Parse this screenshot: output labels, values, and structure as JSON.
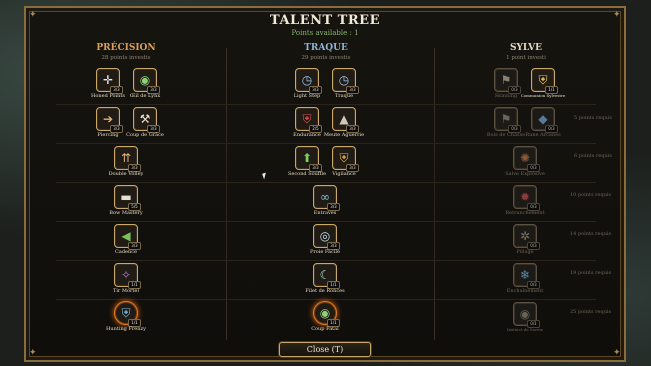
{
  "header": {
    "title": "TALENT TREE",
    "points_available": "Points available : 1"
  },
  "columns": [
    {
      "name": "PRÉCISION",
      "invested": "28 points investis",
      "color": "#d9a05b"
    },
    {
      "name": "TRAQUE",
      "invested": "29 points investis",
      "color": "#8fb3d9"
    },
    {
      "name": "SYLVE",
      "invested": "1 point investi",
      "color": "#e6dcc4"
    }
  ],
  "precision": [
    {
      "label": "Honed Points",
      "rank": "3/3",
      "icon": "crosshair-icon"
    },
    {
      "label": "Œil de Lynx",
      "rank": "3/3",
      "icon": "eye-icon"
    },
    {
      "label": "Piercing",
      "rank": "3/3",
      "icon": "piercing-arrow-icon"
    },
    {
      "label": "Coup de Grâce",
      "rank": "3/3",
      "icon": "axe-icon"
    },
    {
      "label": "Double Volley",
      "rank": "3/3",
      "icon": "triple-arrow-icon"
    },
    {
      "label": "Bow Mastery",
      "rank": "5/5",
      "icon": "bow-icon"
    },
    {
      "label": "Cadence",
      "rank": "3/3",
      "icon": "speed-arrow-icon"
    },
    {
      "label": "Tir Mortel",
      "rank": "1/1",
      "icon": "deadly-shot-icon"
    },
    {
      "label": "Hunting Frenzy",
      "rank": "1/1",
      "icon": "frenzy-shield-icon"
    }
  ],
  "traque": [
    {
      "label": "Light Step",
      "rank": "3/3",
      "icon": "clock-icon"
    },
    {
      "label": "Traque",
      "rank": "3/3",
      "icon": "clock-icon"
    },
    {
      "label": "Endurance",
      "rank": "2/5",
      "icon": "endurance-shield-icon"
    },
    {
      "label": "Meute Aguerrie",
      "rank": "3/3",
      "icon": "pack-icon"
    },
    {
      "label": "Second Souffle",
      "rank": "3/3",
      "icon": "up-arrow-icon"
    },
    {
      "label": "Vigilance",
      "rank": "3/3",
      "icon": "vigilance-shield-icon"
    },
    {
      "label": "Entraves",
      "rank": "3/3",
      "icon": "chains-icon"
    },
    {
      "label": "Proie Facile",
      "rank": "3/3",
      "icon": "target-orb-icon"
    },
    {
      "label": "Filet de Ronces",
      "rank": "1/1",
      "icon": "vine-net-icon"
    },
    {
      "label": "Coup Fatal",
      "rank": "1/1",
      "icon": "fatal-eye-icon"
    }
  ],
  "sylve": [
    {
      "label": "Skinning",
      "rank": "0/3",
      "icon": "flag-icon"
    },
    {
      "label": "Communion Sylvestre",
      "rank": "1/1",
      "icon": "sylvan-shield-icon"
    },
    {
      "label": "Bois de Chasse",
      "rank": "0/3",
      "icon": "flag-icon"
    },
    {
      "label": "Rune Arcanes",
      "rank": "0/3",
      "icon": "rune-icon"
    },
    {
      "label": "Salve Explosive",
      "rank": "0/3",
      "icon": "explosion-icon"
    },
    {
      "label": "Retranchement",
      "rank": "0/3",
      "icon": "entrench-icon"
    },
    {
      "label": "Pillage",
      "rank": "0/3",
      "icon": "pillage-icon"
    },
    {
      "label": "Enchaînement",
      "rank": "0/3",
      "icon": "snowflake-icon"
    },
    {
      "label": "Instinct de Survie",
      "rank": "0/1",
      "icon": "survival-eye-icon"
    }
  ],
  "requirements": [
    "5 points requis",
    "6 points requis",
    "10 points requis",
    "14 points requis",
    "19 points requis",
    "25 points requis"
  ],
  "footer": {
    "close_label": "Close  (T)"
  }
}
